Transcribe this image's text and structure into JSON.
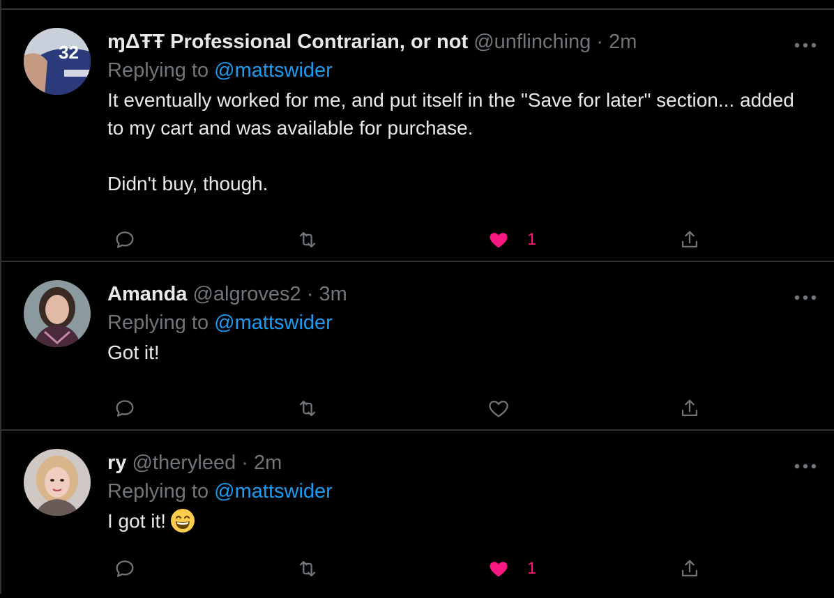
{
  "colors": {
    "background": "#000000",
    "text": "#e7e9ea",
    "muted": "#71767b",
    "link": "#1d9bf0",
    "like": "#f91880",
    "divider": "#2f3336"
  },
  "tweets": [
    {
      "name": "ɱΔŦŦ Professional Contrarian, or not",
      "handle": "@unflinching",
      "separator": "·",
      "time": "2m",
      "replying_prefix": "Replying to",
      "replying_to": "@mattswider",
      "text": "It eventually worked for me, and put itself in the \"Save for later\" section... added to my cart and was available for purchase.\n\nDidn't buy, though.",
      "liked": true,
      "like_count": "1",
      "icons": [
        "reply-icon",
        "retweet-icon",
        "heart-filled-icon",
        "share-icon",
        "more-icon"
      ]
    },
    {
      "name": "Amanda",
      "handle": "@algroves2",
      "separator": "·",
      "time": "3m",
      "replying_prefix": "Replying to",
      "replying_to": "@mattswider",
      "text": "Got it!",
      "liked": false,
      "like_count": "",
      "icons": [
        "reply-icon",
        "retweet-icon",
        "heart-outline-icon",
        "share-icon",
        "more-icon"
      ]
    },
    {
      "name": "ry",
      "handle": "@theryleed",
      "separator": "·",
      "time": "2m",
      "replying_prefix": "Replying to",
      "replying_to": "@mattswider",
      "text": "I got it!",
      "emoji": "grinning-face-emoji",
      "liked": true,
      "like_count": "1",
      "icons": [
        "reply-icon",
        "retweet-icon",
        "heart-filled-icon",
        "share-icon",
        "more-icon"
      ]
    }
  ]
}
